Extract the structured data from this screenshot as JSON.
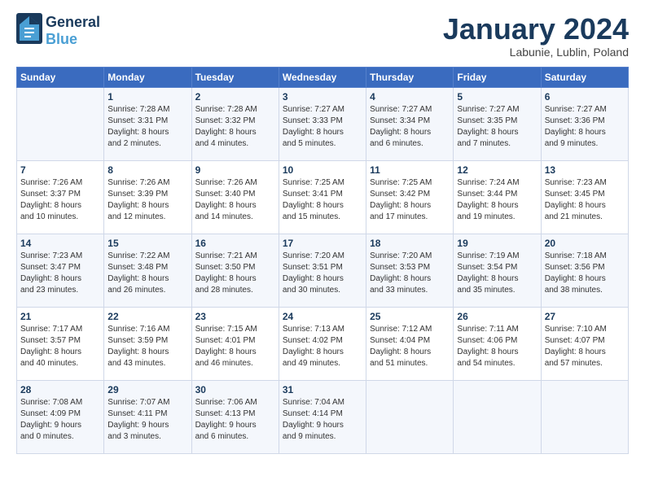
{
  "header": {
    "logo_line1": "General",
    "logo_line2": "Blue",
    "month_title": "January 2024",
    "location": "Labunie, Lublin, Poland"
  },
  "weekdays": [
    "Sunday",
    "Monday",
    "Tuesday",
    "Wednesday",
    "Thursday",
    "Friday",
    "Saturday"
  ],
  "weeks": [
    [
      {
        "day": "",
        "info": ""
      },
      {
        "day": "1",
        "info": "Sunrise: 7:28 AM\nSunset: 3:31 PM\nDaylight: 8 hours\nand 2 minutes."
      },
      {
        "day": "2",
        "info": "Sunrise: 7:28 AM\nSunset: 3:32 PM\nDaylight: 8 hours\nand 4 minutes."
      },
      {
        "day": "3",
        "info": "Sunrise: 7:27 AM\nSunset: 3:33 PM\nDaylight: 8 hours\nand 5 minutes."
      },
      {
        "day": "4",
        "info": "Sunrise: 7:27 AM\nSunset: 3:34 PM\nDaylight: 8 hours\nand 6 minutes."
      },
      {
        "day": "5",
        "info": "Sunrise: 7:27 AM\nSunset: 3:35 PM\nDaylight: 8 hours\nand 7 minutes."
      },
      {
        "day": "6",
        "info": "Sunrise: 7:27 AM\nSunset: 3:36 PM\nDaylight: 8 hours\nand 9 minutes."
      }
    ],
    [
      {
        "day": "7",
        "info": "Sunrise: 7:26 AM\nSunset: 3:37 PM\nDaylight: 8 hours\nand 10 minutes."
      },
      {
        "day": "8",
        "info": "Sunrise: 7:26 AM\nSunset: 3:39 PM\nDaylight: 8 hours\nand 12 minutes."
      },
      {
        "day": "9",
        "info": "Sunrise: 7:26 AM\nSunset: 3:40 PM\nDaylight: 8 hours\nand 14 minutes."
      },
      {
        "day": "10",
        "info": "Sunrise: 7:25 AM\nSunset: 3:41 PM\nDaylight: 8 hours\nand 15 minutes."
      },
      {
        "day": "11",
        "info": "Sunrise: 7:25 AM\nSunset: 3:42 PM\nDaylight: 8 hours\nand 17 minutes."
      },
      {
        "day": "12",
        "info": "Sunrise: 7:24 AM\nSunset: 3:44 PM\nDaylight: 8 hours\nand 19 minutes."
      },
      {
        "day": "13",
        "info": "Sunrise: 7:23 AM\nSunset: 3:45 PM\nDaylight: 8 hours\nand 21 minutes."
      }
    ],
    [
      {
        "day": "14",
        "info": "Sunrise: 7:23 AM\nSunset: 3:47 PM\nDaylight: 8 hours\nand 23 minutes."
      },
      {
        "day": "15",
        "info": "Sunrise: 7:22 AM\nSunset: 3:48 PM\nDaylight: 8 hours\nand 26 minutes."
      },
      {
        "day": "16",
        "info": "Sunrise: 7:21 AM\nSunset: 3:50 PM\nDaylight: 8 hours\nand 28 minutes."
      },
      {
        "day": "17",
        "info": "Sunrise: 7:20 AM\nSunset: 3:51 PM\nDaylight: 8 hours\nand 30 minutes."
      },
      {
        "day": "18",
        "info": "Sunrise: 7:20 AM\nSunset: 3:53 PM\nDaylight: 8 hours\nand 33 minutes."
      },
      {
        "day": "19",
        "info": "Sunrise: 7:19 AM\nSunset: 3:54 PM\nDaylight: 8 hours\nand 35 minutes."
      },
      {
        "day": "20",
        "info": "Sunrise: 7:18 AM\nSunset: 3:56 PM\nDaylight: 8 hours\nand 38 minutes."
      }
    ],
    [
      {
        "day": "21",
        "info": "Sunrise: 7:17 AM\nSunset: 3:57 PM\nDaylight: 8 hours\nand 40 minutes."
      },
      {
        "day": "22",
        "info": "Sunrise: 7:16 AM\nSunset: 3:59 PM\nDaylight: 8 hours\nand 43 minutes."
      },
      {
        "day": "23",
        "info": "Sunrise: 7:15 AM\nSunset: 4:01 PM\nDaylight: 8 hours\nand 46 minutes."
      },
      {
        "day": "24",
        "info": "Sunrise: 7:13 AM\nSunset: 4:02 PM\nDaylight: 8 hours\nand 49 minutes."
      },
      {
        "day": "25",
        "info": "Sunrise: 7:12 AM\nSunset: 4:04 PM\nDaylight: 8 hours\nand 51 minutes."
      },
      {
        "day": "26",
        "info": "Sunrise: 7:11 AM\nSunset: 4:06 PM\nDaylight: 8 hours\nand 54 minutes."
      },
      {
        "day": "27",
        "info": "Sunrise: 7:10 AM\nSunset: 4:07 PM\nDaylight: 8 hours\nand 57 minutes."
      }
    ],
    [
      {
        "day": "28",
        "info": "Sunrise: 7:08 AM\nSunset: 4:09 PM\nDaylight: 9 hours\nand 0 minutes."
      },
      {
        "day": "29",
        "info": "Sunrise: 7:07 AM\nSunset: 4:11 PM\nDaylight: 9 hours\nand 3 minutes."
      },
      {
        "day": "30",
        "info": "Sunrise: 7:06 AM\nSunset: 4:13 PM\nDaylight: 9 hours\nand 6 minutes."
      },
      {
        "day": "31",
        "info": "Sunrise: 7:04 AM\nSunset: 4:14 PM\nDaylight: 9 hours\nand 9 minutes."
      },
      {
        "day": "",
        "info": ""
      },
      {
        "day": "",
        "info": ""
      },
      {
        "day": "",
        "info": ""
      }
    ]
  ]
}
